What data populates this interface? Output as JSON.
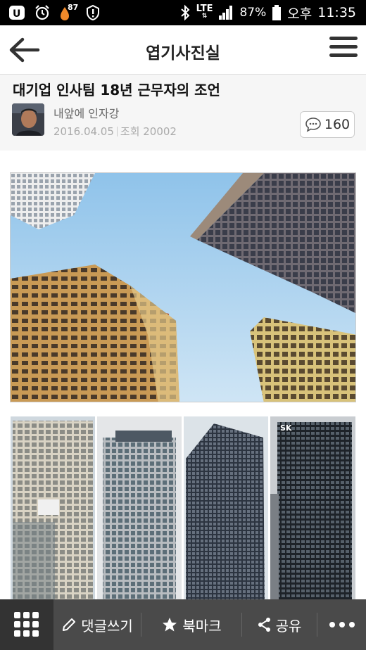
{
  "status_bar": {
    "app_badge": "87",
    "network": "LTE",
    "battery": "87%",
    "ampm": "오후",
    "time": "11:35"
  },
  "appbar": {
    "title": "엽기사진실"
  },
  "post": {
    "title": "대기업 인사팀 18년 근무자의 조언",
    "author": "내앞에 인자강",
    "date": "2016.04.05",
    "views": "조회 20002",
    "comment_count": "160"
  },
  "images": {
    "second_sign": "SK"
  },
  "toolbar": {
    "comment_label": "댓글쓰기",
    "bookmark_label": "북마크",
    "share_label": "공유"
  },
  "icons": [
    "app-icon",
    "alarm-icon",
    "weather-icon",
    "alert-icon",
    "bluetooth-icon",
    "signal-icon",
    "battery-icon",
    "back-arrow-icon",
    "hamburger-menu-icon",
    "comment-bubble-icon",
    "grid-icon",
    "pencil-icon",
    "star-icon",
    "share-icon",
    "more-dots-icon"
  ]
}
